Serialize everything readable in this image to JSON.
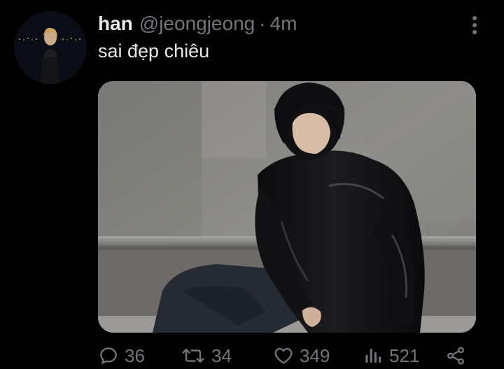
{
  "tweet": {
    "display_name": "han",
    "handle": "@jeongjeong",
    "separator": "·",
    "time": "4m",
    "text": "sai đẹp chiêu"
  },
  "actions": {
    "reply_count": "36",
    "retweet_count": "34",
    "like_count": "349",
    "view_count": "521"
  },
  "icons": {
    "more": "more-vertical-icon",
    "reply": "reply-icon",
    "retweet": "retweet-icon",
    "like": "heart-icon",
    "views": "analytics-icon",
    "share": "share-icon"
  },
  "colors": {
    "background": "#000000",
    "primary_text": "#e7e9ea",
    "secondary_text": "#71767b"
  }
}
